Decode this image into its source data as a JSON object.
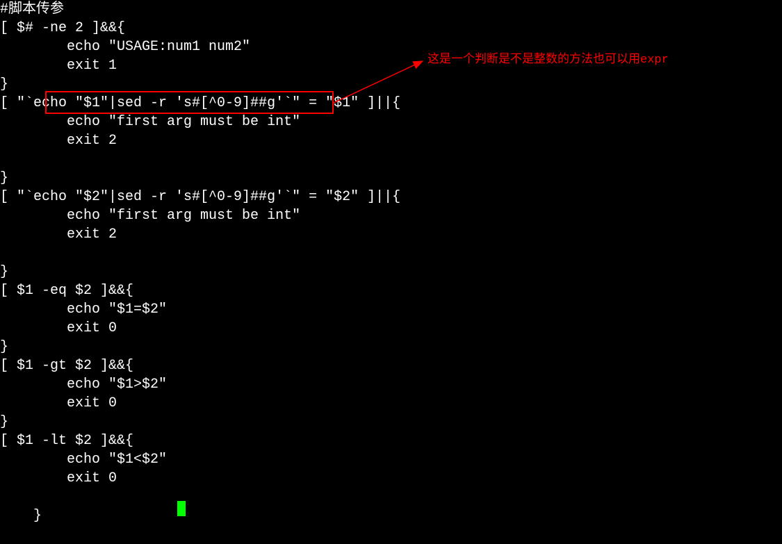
{
  "annotation": {
    "text": "这是一个判断是不是整数的方法也可以用expr"
  },
  "code": {
    "line01": "#脚本传参",
    "line02": "[ $# -ne 2 ]&&{",
    "line03": "        echo \"USAGE:num1 num2\"",
    "line04": "        exit 1",
    "line05": "}",
    "line06": "[ \"`echo \"$1\"|sed -r 's#[^0-9]##g'`\" = \"$1\" ]||{",
    "line07": "        echo \"first arg must be int\"",
    "line08": "        exit 2",
    "line09": "",
    "line10": "}",
    "line11": "[ \"`echo \"$2\"|sed -r 's#[^0-9]##g'`\" = \"$2\" ]||{",
    "line12": "        echo \"first arg must be int\"",
    "line13": "        exit 2",
    "line14": "",
    "line15": "}",
    "line16": "[ $1 -eq $2 ]&&{",
    "line17": "        echo \"$1=$2\"",
    "line18": "        exit 0",
    "line19": "}",
    "line20": "[ $1 -gt $2 ]&&{",
    "line21": "        echo \"$1>$2\"",
    "line22": "        exit 0",
    "line23": "}",
    "line24": "[ $1 -lt $2 ]&&{",
    "line25": "        echo \"$1<$2\"",
    "line26": "        exit 0",
    "line27": "}"
  }
}
